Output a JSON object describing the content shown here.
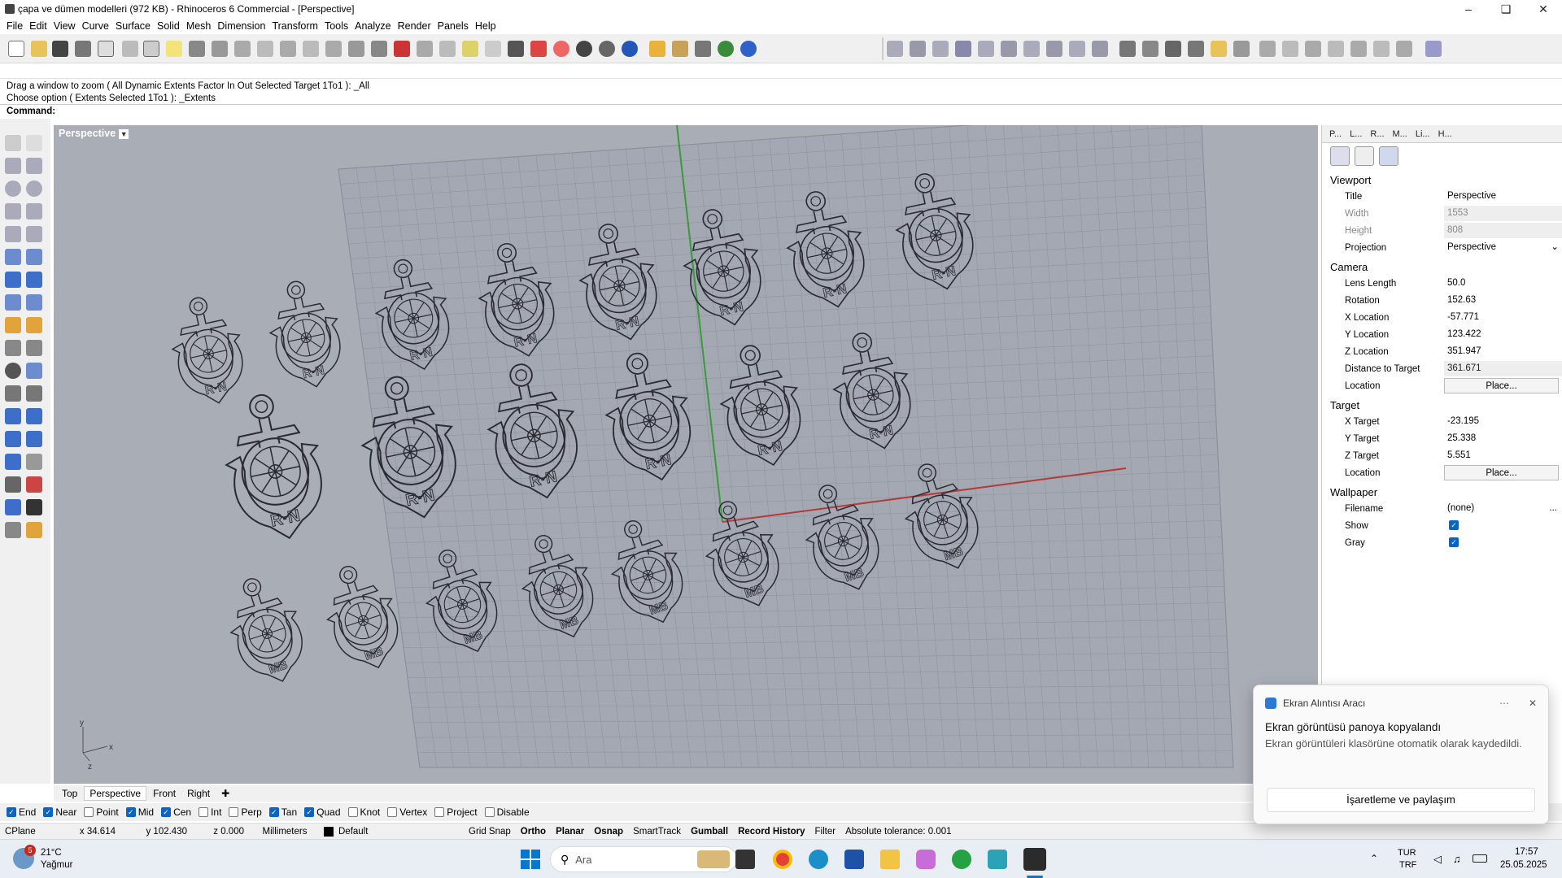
{
  "window": {
    "title": "çapa ve dümen modelleri (972 KB) - Rhinoceros 6 Commercial - [Perspective]"
  },
  "menu": [
    "File",
    "Edit",
    "View",
    "Curve",
    "Surface",
    "Solid",
    "Mesh",
    "Dimension",
    "Transform",
    "Tools",
    "Analyze",
    "Render",
    "Panels",
    "Help"
  ],
  "command": {
    "history": [
      "Drag a window to zoom ( All  Dynamic  Extents  Factor  In  Out  Selected  Target  1To1 ): _All",
      "Choose option ( Extents  Selected  1To1 ): _Extents"
    ],
    "prompt": "Command:"
  },
  "viewport": {
    "title": "Perspective",
    "models_rn": "R·N",
    "models_mb": "MB",
    "axes": {
      "x": "x",
      "y": "y",
      "z": "z"
    }
  },
  "view_tabs": [
    "Top",
    "Perspective",
    "Front",
    "Right"
  ],
  "panel": {
    "tabs": [
      "P...",
      "L...",
      "R...",
      "M...",
      "Li...",
      "H..."
    ],
    "viewport_header": "Viewport",
    "title_label": "Title",
    "title_value": "Perspective",
    "width_label": "Width",
    "width_value": "1553",
    "height_label": "Height",
    "height_value": "808",
    "projection_label": "Projection",
    "projection_value": "Perspective",
    "camera_header": "Camera",
    "lens_label": "Lens Length",
    "lens_value": "50.0",
    "rotation_label": "Rotation",
    "rotation_value": "152.63",
    "xloc_label": "X Location",
    "xloc_value": "-57.771",
    "yloc_label": "Y Location",
    "yloc_value": "123.422",
    "zloc_label": "Z Location",
    "zloc_value": "351.947",
    "dist_label": "Distance to Target",
    "dist_value": "361.671",
    "location_label": "Location",
    "place_label": "Place...",
    "target_header": "Target",
    "xt_label": "X Target",
    "xt_value": "-23.195",
    "yt_label": "Y Target",
    "yt_value": "25.338",
    "zt_label": "Z Target",
    "zt_value": "5.551",
    "wallpaper_header": "Wallpaper",
    "filename_label": "Filename",
    "filename_value": "(none)",
    "show_label": "Show",
    "gray_label": "Gray"
  },
  "osnaps": [
    {
      "label": "End",
      "on": true
    },
    {
      "label": "Near",
      "on": true
    },
    {
      "label": "Point",
      "on": false
    },
    {
      "label": "Mid",
      "on": true
    },
    {
      "label": "Cen",
      "on": true
    },
    {
      "label": "Int",
      "on": false
    },
    {
      "label": "Perp",
      "on": false
    },
    {
      "label": "Tan",
      "on": true
    },
    {
      "label": "Quad",
      "on": true
    },
    {
      "label": "Knot",
      "on": false
    },
    {
      "label": "Vertex",
      "on": false
    },
    {
      "label": "Project",
      "on": false
    },
    {
      "label": "Disable",
      "on": false
    }
  ],
  "status": {
    "cplane": "CPlane",
    "x": "x 34.614",
    "y": "y 102.430",
    "z": "z 0.000",
    "units": "Millimeters",
    "layer": "Default",
    "grid_snap": "Grid Snap",
    "ortho": "Ortho",
    "planar": "Planar",
    "osnap": "Osnap",
    "smarttrack": "SmartTrack",
    "gumball": "Gumball",
    "record_history": "Record History",
    "filter": "Filter",
    "tolerance": "Absolute tolerance: 0.001"
  },
  "toast": {
    "app": "Ekran Alıntısı Aracı",
    "title": "Ekran görüntüsü panoya kopyalandı",
    "message": "Ekran görüntüleri klasörüne otomatik olarak kaydedildi.",
    "action": "İşaretleme ve paylaşım"
  },
  "taskbar": {
    "weather_temp": "21°C",
    "weather_desc": "Yağmur",
    "weather_badge": "5",
    "search": "Ara",
    "lang1": "TUR",
    "lang2": "TRF",
    "time": "17:57",
    "date": "25.05.2025"
  },
  "colors": {
    "viewport_bg": "#a9adb6",
    "x_axis": "#b53a3a",
    "y_axis": "#3b9a3b",
    "accent": "#0a64c2"
  }
}
